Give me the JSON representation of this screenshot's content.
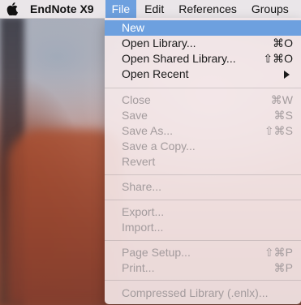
{
  "menubar": {
    "apple_icon": "apple-icon",
    "app_name": "EndNote X9",
    "menus": [
      "File",
      "Edit",
      "References",
      "Groups"
    ],
    "active_menu": "File"
  },
  "file_menu": {
    "items": [
      {
        "label": "New",
        "shortcut": "",
        "enabled": true,
        "highlighted": true
      },
      {
        "label": "Open Library...",
        "shortcut": "⌘O",
        "enabled": true
      },
      {
        "label": "Open Shared Library...",
        "shortcut": "⇧⌘O",
        "enabled": true
      },
      {
        "label": "Open Recent",
        "shortcut": "",
        "enabled": true,
        "submenu_icon": "triangle-right-icon"
      },
      {
        "label": "Close",
        "shortcut": "⌘W",
        "enabled": false
      },
      {
        "label": "Save",
        "shortcut": "⌘S",
        "enabled": false
      },
      {
        "label": "Save As...",
        "shortcut": "⇧⌘S",
        "enabled": false
      },
      {
        "label": "Save a Copy...",
        "shortcut": "",
        "enabled": false
      },
      {
        "label": "Revert",
        "shortcut": "",
        "enabled": false
      },
      {
        "label": "Share...",
        "shortcut": "",
        "enabled": false
      },
      {
        "label": "Export...",
        "shortcut": "",
        "enabled": false
      },
      {
        "label": "Import...",
        "shortcut": "",
        "enabled": false
      },
      {
        "label": "Page Setup...",
        "shortcut": "⇧⌘P",
        "enabled": false
      },
      {
        "label": "Print...",
        "shortcut": "⌘P",
        "enabled": false
      },
      {
        "label": "Compressed Library (.enlx)...",
        "shortcut": "",
        "enabled": false
      }
    ]
  },
  "colors": {
    "highlight": "#6da0df",
    "enabled_text": "#1a1a1a",
    "disabled_text": "#a39b9d"
  }
}
